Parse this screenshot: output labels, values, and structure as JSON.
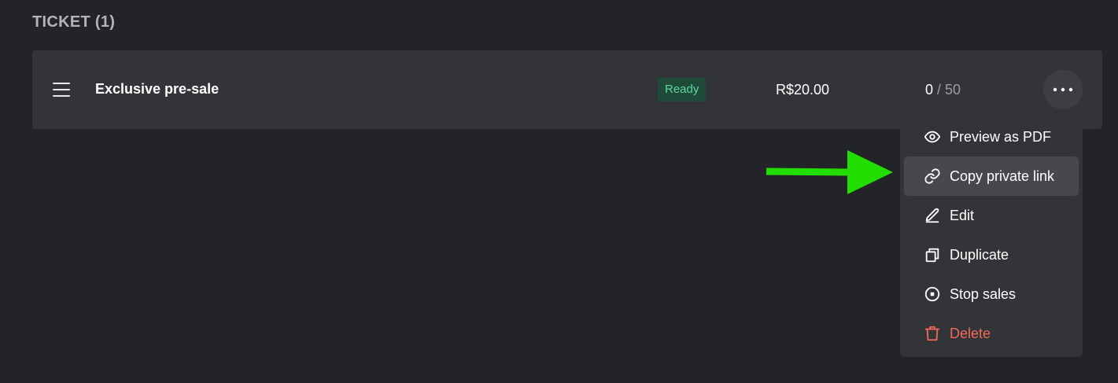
{
  "section": {
    "title": "TICKET (1)"
  },
  "ticket": {
    "name": "Exclusive pre-sale",
    "status": "Ready",
    "price": "R$20.00",
    "sold": "0",
    "separator": " / ",
    "capacity": "50"
  },
  "more_button": {
    "icon": "more-horizontal-icon"
  },
  "menu": {
    "items": [
      {
        "label": "Preview as PDF",
        "icon": "eye-icon"
      },
      {
        "label": "Copy private link",
        "icon": "link-icon",
        "highlighted": true
      },
      {
        "label": "Edit",
        "icon": "pencil-icon"
      },
      {
        "label": "Duplicate",
        "icon": "copy-icon"
      },
      {
        "label": "Stop sales",
        "icon": "stop-circle-icon"
      },
      {
        "label": "Delete",
        "icon": "trash-icon",
        "color": "#f0695b"
      }
    ]
  },
  "annotation": {
    "arrow_color": "#22dd00"
  },
  "colors": {
    "background": "#222427",
    "row": "#333438",
    "badge_bg": "#1f4a3a",
    "badge_text": "#5fd6a1",
    "danger": "#f0695b"
  }
}
